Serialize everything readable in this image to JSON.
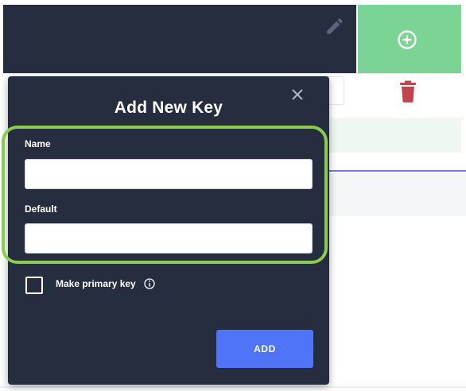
{
  "modal": {
    "title": "Add New Key",
    "name_label": "Name",
    "name_value": "",
    "default_label": "Default",
    "default_value": "",
    "checkbox_label": "Make primary key",
    "checkbox_checked": false,
    "add_button_label": "ADD"
  },
  "icons": {
    "background_header": [
      "pencil-icon"
    ],
    "background_add_tile": [
      "plus-circle-icon"
    ],
    "background_row": [
      "trash-icon"
    ],
    "modal_close": "close-icon",
    "info": "info-icon"
  },
  "colors": {
    "modal_bg": "#252d3e",
    "add_tile_green": "#7bd394",
    "highlight_green": "#8bcb4f",
    "add_button_blue": "#4f74f7",
    "trash_red": "#c2434b",
    "separator_blue": "#6a7ee0"
  }
}
